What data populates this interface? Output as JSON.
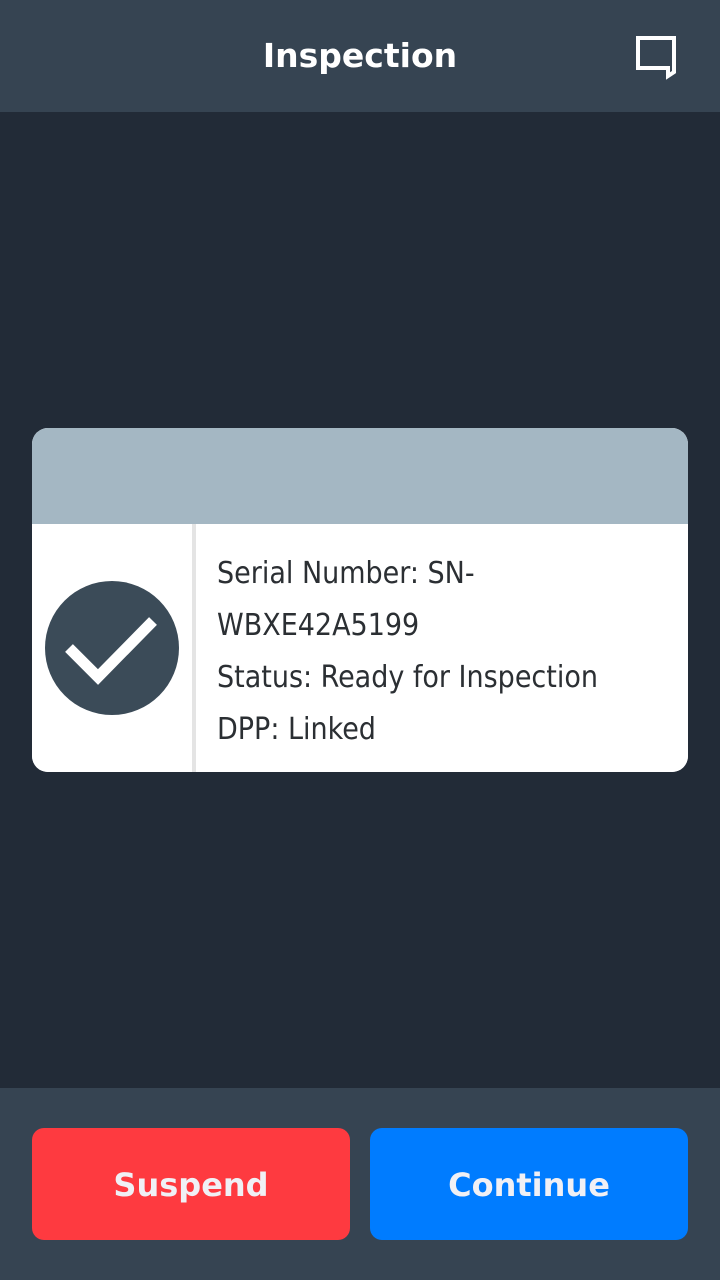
{
  "header": {
    "title": "Inspection",
    "chat_icon": "chat-bubble-icon"
  },
  "card": {
    "status_icon": "check-circle-icon",
    "serial_line_1": "Serial Number: SN-",
    "serial_line_2": "WBXE42A5199",
    "status_line": "Status: Ready for Inspection",
    "dpp_line": "DPP: Linked"
  },
  "actions": {
    "suspend_label": "Suspend",
    "continue_label": "Continue"
  },
  "colors": {
    "app_bar": "#364452",
    "background": "#222b37",
    "card_header": "#a4b7c3",
    "check_circle": "#3b4b58",
    "suspend": "#fe3a40",
    "continue": "#007cff"
  }
}
